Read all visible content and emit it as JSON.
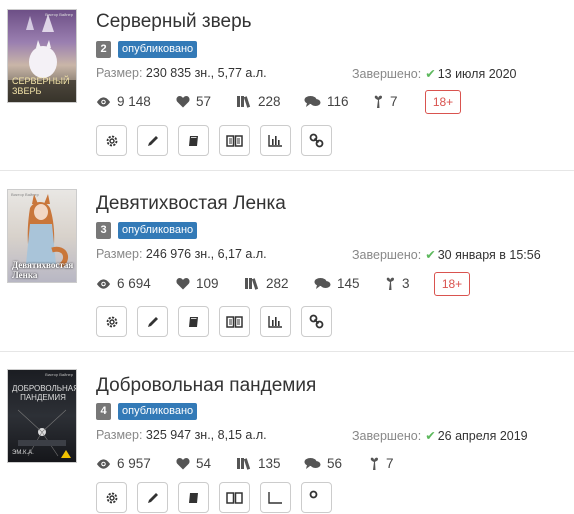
{
  "books": [
    {
      "cover": {
        "title": "СЕРВЕРНЫЙ ЗВЕРЬ",
        "author": "Виктор Вайнер"
      },
      "title": "Серверный зверь",
      "number": "2",
      "status": "опубликовано",
      "size_label": "Размер:",
      "size_value": "230 835 зн., 5,77 а.л.",
      "done_label": "Завершено:",
      "done_date": "13 июля 2020",
      "views": "9 148",
      "likes": "57",
      "libraries": "228",
      "comments": "116",
      "awards": "7",
      "age": "18+"
    },
    {
      "cover": {
        "title": "Девятихвостая Ленка",
        "author": "Виктор Вайнер"
      },
      "title": "Девятихвостая Ленка",
      "number": "3",
      "status": "опубликовано",
      "size_label": "Размер:",
      "size_value": "246 976 зн., 6,17 а.л.",
      "done_label": "Завершено:",
      "done_date": "30 января в 15:56",
      "views": "6 694",
      "likes": "109",
      "libraries": "282",
      "comments": "145",
      "awards": "3",
      "age": "18+"
    },
    {
      "cover": {
        "title": "ДОБРОВОЛЬНАЯ ПАНДЕМИЯ",
        "author": "Виктор Вайнер",
        "badge": "ЭМ.К.А."
      },
      "title": "Добровольная пандемия",
      "number": "4",
      "status": "опубликовано",
      "size_label": "Размер:",
      "size_value": "325 947 зн., 8,15 а.л.",
      "done_label": "Завершено:",
      "done_date": "26 апреля 2019",
      "views": "6 957",
      "likes": "54",
      "libraries": "135",
      "comments": "56",
      "awards": "7"
    }
  ],
  "icons": {
    "views": "eye-icon",
    "likes": "heart-icon",
    "libraries": "books-icon",
    "comments": "comments-icon",
    "awards": "award-icon",
    "tools": [
      "gear-icon",
      "pencil-icon",
      "book-icon",
      "open-book-icon",
      "chart-icon",
      "link-icon"
    ]
  },
  "colors": {
    "status": "#337ab7",
    "number": "#777777",
    "age": "#d9534f",
    "check": "#5cb85c"
  }
}
